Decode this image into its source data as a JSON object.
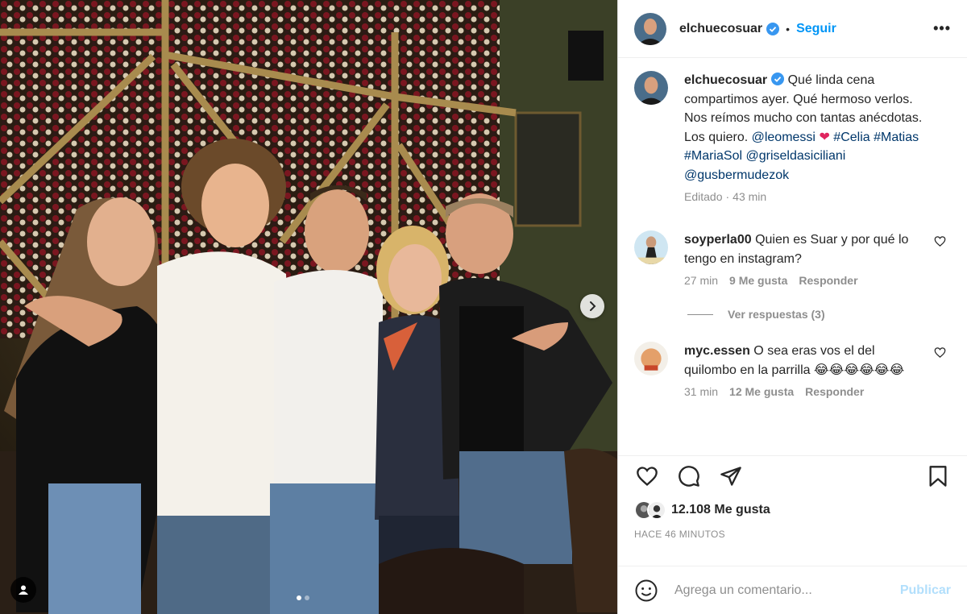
{
  "post": {
    "author": "elchuecosuar",
    "verified": true,
    "separator": "•",
    "follow_label": "Seguir",
    "more_label": "•••",
    "carousel_dots": 2,
    "active_dot": 0
  },
  "caption": {
    "author": "elchuecosuar",
    "text_1": "Qué linda cena compartimos ayer. Qué hermoso verlos. Nos reímos mucho con tantas anécdotas. Los quiero. ",
    "mention_1": "@leomessi",
    "heart": "❤",
    "hashtags": "#Celia #Matias #MariaSol",
    "mention_2": "@griseldasiciliani",
    "mention_3": "@gusbermudezok",
    "edited": "Editado",
    "dot": "·",
    "time": "43 min"
  },
  "comments": [
    {
      "user": "soyperla00",
      "text": "Quien es Suar y por qué lo tengo en instagram?",
      "time": "27 min",
      "likes": "9 Me gusta",
      "reply": "Responder",
      "view_replies": "Ver respuestas (3)"
    },
    {
      "user": "myc.essen",
      "text": "O sea eras vos el del quilombo en la parrilla 😂😂😂😂😂😂",
      "time": "31 min",
      "likes": "12 Me gusta",
      "reply": "Responder"
    }
  ],
  "actions": {
    "likes_count": "12.108 Me gusta",
    "time_ago": "HACE 46 MINUTOS"
  },
  "comment_box": {
    "placeholder": "Agrega un comentario...",
    "post_label": "Publicar"
  },
  "colors": {
    "accent": "#0095f6",
    "verified": "#3897f0",
    "link": "#00376b",
    "muted": "#8e8e8e",
    "heart": "#e0245e",
    "post_disabled": "#b2dffc"
  }
}
